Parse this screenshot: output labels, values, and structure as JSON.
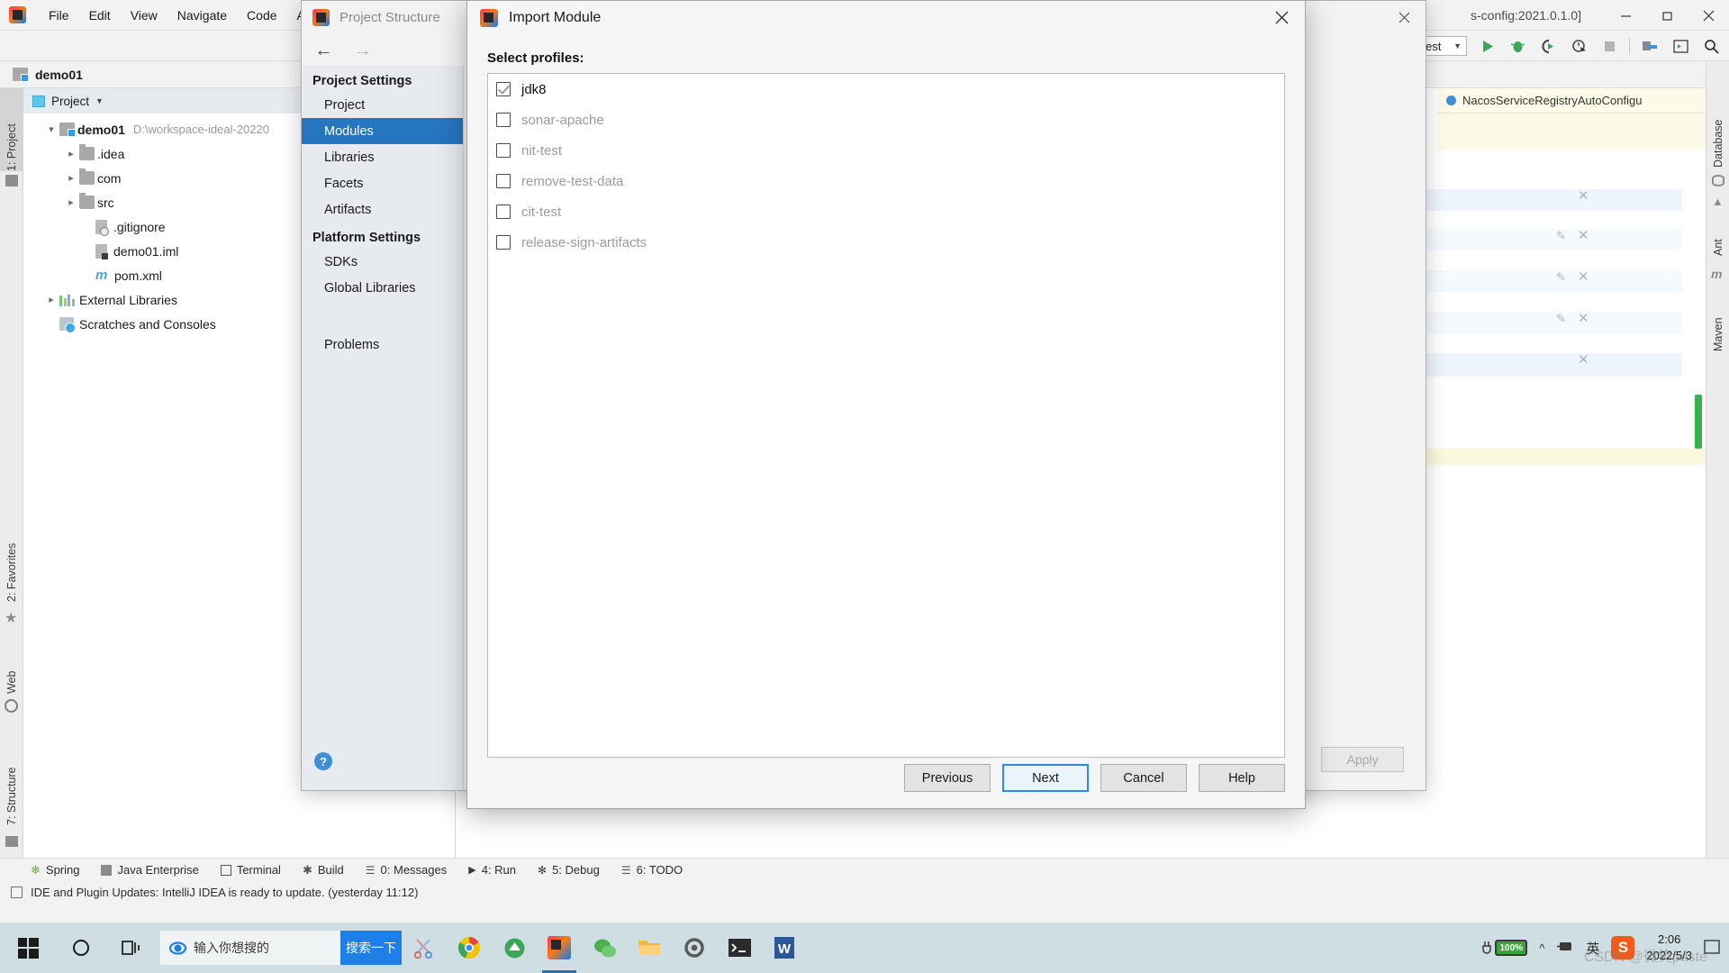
{
  "ide": {
    "app_icon": "intellij-logo-icon",
    "menu": [
      "File",
      "Edit",
      "View",
      "Navigate",
      "Code",
      "A"
    ],
    "window_title_fragment": "s-config:2021.0.1.0]",
    "project_name": "demo01",
    "project_panel_title": "Project",
    "run_config": "est",
    "breadcrumb": "NacosServiceRegistryAutoConfigu",
    "toolbar_icons": [
      "run-icon",
      "debug-icon",
      "run-with-coverage-icon",
      "profile-icon",
      "stop-icon",
      "project-structure-icon",
      "terminal-icon",
      "search-everywhere-icon"
    ],
    "window_controls": [
      "minimize-icon",
      "maximize-icon",
      "close-icon"
    ],
    "left_rail": [
      "1: Project",
      "2: Favorites",
      "Web",
      "7: Structure"
    ],
    "right_rail": [
      "Database",
      "Ant",
      "Maven"
    ]
  },
  "tree": {
    "root": {
      "label": "demo01",
      "path": "D:\\workspace-ideal-20220",
      "expanded": true
    },
    "items": [
      {
        "label": ".idea",
        "icon": "folder-icon",
        "twisty": "collapsed",
        "indent": 2
      },
      {
        "label": "com",
        "icon": "folder-icon",
        "twisty": "collapsed",
        "indent": 2
      },
      {
        "label": "src",
        "icon": "folder-icon",
        "twisty": "collapsed",
        "indent": 2
      },
      {
        "label": ".gitignore",
        "icon": "gitignore-file-icon",
        "twisty": "none",
        "indent": 3
      },
      {
        "label": "demo01.iml",
        "icon": "iml-file-icon",
        "twisty": "none",
        "indent": 3
      },
      {
        "label": "pom.xml",
        "icon": "maven-file-icon",
        "twisty": "none",
        "indent": 3
      },
      {
        "label": "External Libraries",
        "icon": "libraries-icon",
        "twisty": "collapsed",
        "indent": 1
      },
      {
        "label": "Scratches and Consoles",
        "icon": "scratches-icon",
        "twisty": "none",
        "indent": 1
      }
    ]
  },
  "project_structure": {
    "title": "Project Structure",
    "back_arrow": "back-arrow-icon",
    "forward_arrow": "forward-arrow-icon",
    "close": "close-icon",
    "groups": [
      {
        "heading": "Project Settings",
        "items": [
          "Project",
          "Modules",
          "Libraries",
          "Facets",
          "Artifacts"
        ]
      },
      {
        "heading": "Platform Settings",
        "items": [
          "SDKs",
          "Global Libraries"
        ]
      }
    ],
    "extra_items": [
      "Problems"
    ],
    "selected_item": "Modules",
    "help_button": "?",
    "apply_label": "Apply"
  },
  "import_module": {
    "title": "Import Module",
    "icon": "intellij-logo-icon",
    "close": "close-icon",
    "section_label": "Select profiles:",
    "profiles": [
      {
        "name": "jdk8",
        "checked": true,
        "enabled": true
      },
      {
        "name": "sonar-apache",
        "checked": false,
        "enabled": false
      },
      {
        "name": "nit-test",
        "checked": false,
        "enabled": false
      },
      {
        "name": "remove-test-data",
        "checked": false,
        "enabled": false
      },
      {
        "name": "cit-test",
        "checked": false,
        "enabled": false
      },
      {
        "name": "release-sign-artifacts",
        "checked": false,
        "enabled": false
      }
    ],
    "buttons": [
      {
        "label": "Previous",
        "default": false
      },
      {
        "label": "Next",
        "default": true
      },
      {
        "label": "Cancel",
        "default": false
      },
      {
        "label": "Help",
        "default": false
      }
    ]
  },
  "tool_windows": [
    {
      "label": "Spring",
      "icon": "spring-leaf-icon"
    },
    {
      "label": "Java Enterprise",
      "icon": "java-enterprise-icon"
    },
    {
      "label": "Terminal",
      "icon": "terminal-icon"
    },
    {
      "label": "Build",
      "icon": "build-hammer-icon"
    },
    {
      "label": "0: Messages",
      "icon": "messages-icon"
    },
    {
      "label": "4: Run",
      "icon": "run-icon"
    },
    {
      "label": "5: Debug",
      "icon": "debug-icon"
    },
    {
      "label": "6: TODO",
      "icon": "todo-icon"
    }
  ],
  "status": {
    "icon": "update-notification-icon",
    "text": "IDE and Plugin Updates: IntelliJ IDEA is ready to update. (yesterday 11:12)"
  },
  "taskbar": {
    "start": "windows-start-icon",
    "cortana": "cortana-circle-icon",
    "task_view": "task-view-icon",
    "search_placeholder": "输入你想搜的",
    "search_button": "搜索一下",
    "browser_icon": "internet-explorer-icon",
    "apps": [
      "snip-tool-icon",
      "chrome-icon",
      "qq-browser-icon",
      "intellij-idea-icon",
      "wechat-icon",
      "file-explorer-icon",
      "settings-gear-icon",
      "console-icon",
      "word-icon"
    ],
    "tray": {
      "battery": "100%",
      "battery_icon": "battery-charging-icon",
      "chevron": "show-hidden-icons-icon",
      "power_icon": "power-icon",
      "ime_mode": "英",
      "sogou_icon": "sogou-input-icon",
      "time": "2:06",
      "date": "2022/5/3",
      "notification_icon": "action-center-icon"
    },
    "watermark": "CSDN @微笑paste"
  }
}
